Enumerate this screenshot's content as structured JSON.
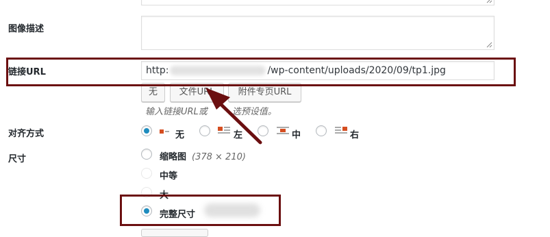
{
  "form": {
    "image_description_label": "图像描述",
    "link_url_label": "链接URL",
    "link_url_value_prefix": "http:",
    "link_url_value_suffix": "/wp-content/uploads/2020/09/tp1.jpg",
    "link_buttons": {
      "none": "无",
      "file_url": "文件URL",
      "attachment_page_url": "附件专页URL"
    },
    "link_help_prefix": "输入链接URL或",
    "link_help_suffix": "选预设值。",
    "align_label": "对齐方式",
    "align_options": [
      {
        "label": "无",
        "icon": "align-none-icon",
        "checked": true
      },
      {
        "label": "左",
        "icon": "align-left-icon",
        "checked": false
      },
      {
        "label": "中",
        "icon": "align-center-icon",
        "checked": false
      },
      {
        "label": "右",
        "icon": "align-right-icon",
        "checked": false
      }
    ],
    "size_label": "尺寸",
    "size_options": [
      {
        "label": "缩略图",
        "dims": "(378 × 210)",
        "checked": false
      },
      {
        "label": "中等",
        "checked": false
      },
      {
        "label": "大",
        "checked": false
      },
      {
        "label": "完整尺寸",
        "checked": true
      }
    ]
  },
  "colors": {
    "highlight_border": "#6b0f10",
    "radio_checked": "#1e8cbe",
    "icon_red": "#d54e21"
  }
}
